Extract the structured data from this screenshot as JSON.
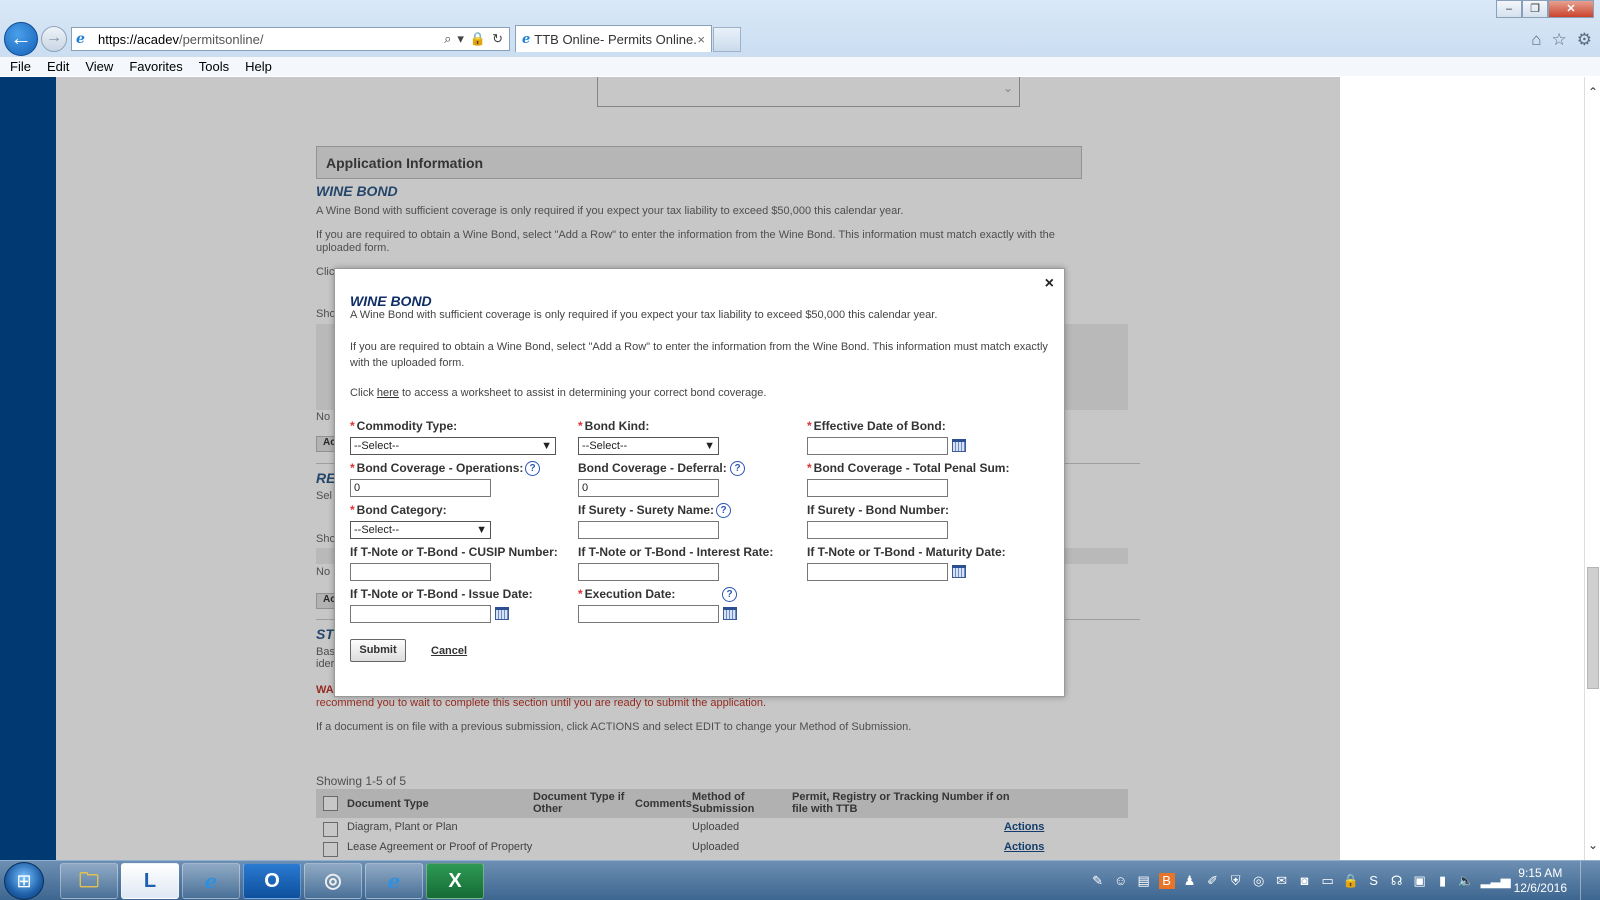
{
  "browser": {
    "url_host": "https://acadev",
    "url_path": "/permitsonline/",
    "tab_title": "TTB Online- Permits Online...",
    "tab_close": "×",
    "menu": [
      "File",
      "Edit",
      "View",
      "Favorites",
      "Tools",
      "Help"
    ],
    "window_controls": {
      "minimize": "–",
      "restore": "❐",
      "close": "✕"
    }
  },
  "background_page": {
    "section_header": "Application Information",
    "wine_bond_title": "WINE BOND",
    "wine_bond_p1": "A Wine Bond with sufficient coverage is only required if you expect your tax liability to exceed $50,000 this calendar year.",
    "wine_bond_p2": "If you are required to obtain a Wine Bond, select \"Add a Row\" to enter the information from the Wine Bond. This information must match exactly with the uploaded form.",
    "frag_click": "Clic",
    "frag_show1": "Sho",
    "frag_no1": "No",
    "frag_add1": "Ac",
    "frag_re": "RE",
    "frag_sel": "Sel",
    "frag_show2": "Sho",
    "frag_no2": "No",
    "frag_add2": "Ac",
    "frag_st": "ST",
    "frag_bas": "Bas",
    "frag_ider": "ider",
    "warning_label": "WARNING:",
    "warning_text": " Any information added within this Section will NOT be saved if you place the application in a Save and Resume Status. Therefore, we recommend you to wait to complete this section until you are ready to submit the application.",
    "doc_note": "If a document is on file with a previous submission, click ACTIONS and select EDIT to change your Method of Submission.",
    "showing": "Showing 1-5 of 5",
    "doc_headers": [
      "Document Type",
      "Document Type if Other",
      "Comments",
      "Method of Submission",
      "Permit, Registry or Tracking Number if on file with TTB"
    ],
    "doc_rows": [
      {
        "type": "Diagram, Plant or Plan",
        "method": "Uploaded",
        "actions": "Actions"
      },
      {
        "type": "Lease Agreement or Proof of Property",
        "method": "Uploaded",
        "actions": "Actions"
      }
    ]
  },
  "modal": {
    "close": "×",
    "title": "WINE BOND",
    "p1": "A Wine Bond with sufficient coverage is only required if you expect your tax liability to exceed $50,000 this calendar year.",
    "p2": "If you are required to obtain a Wine Bond, select \"Add a Row\" to enter the information from the Wine Bond. This information must match exactly with the uploaded form.",
    "p3_before": "Click ",
    "p3_link": "here",
    "p3_after": " to access a worksheet to assist in determining your correct bond coverage.",
    "required_mark": "*",
    "help_glyph": "?",
    "fields": {
      "commodity_type": {
        "label": "Commodity Type:",
        "value": "--Select--"
      },
      "bond_kind": {
        "label": "Bond Kind:",
        "value": "--Select--"
      },
      "effective_date": {
        "label": "Effective Date of Bond:",
        "value": ""
      },
      "coverage_operations": {
        "label": "Bond Coverage - Operations:",
        "value": "0"
      },
      "coverage_deferral": {
        "label": "Bond Coverage - Deferral:",
        "value": "0"
      },
      "coverage_total": {
        "label": "Bond Coverage - Total Penal Sum:",
        "value": ""
      },
      "bond_category": {
        "label": "Bond Category:",
        "value": "--Select--"
      },
      "surety_name": {
        "label": "If Surety - Surety Name:",
        "value": ""
      },
      "surety_bond_number": {
        "label": "If Surety - Bond Number:",
        "value": ""
      },
      "cusip_number": {
        "label": "If T-Note or T-Bond - CUSIP Number:",
        "value": ""
      },
      "interest_rate": {
        "label": "If T-Note or T-Bond - Interest Rate:",
        "value": ""
      },
      "maturity_date": {
        "label": "If T-Note or T-Bond - Maturity Date:",
        "value": ""
      },
      "issue_date": {
        "label": "If T-Note or T-Bond - Issue Date:",
        "value": ""
      },
      "execution_date": {
        "label": "Execution Date:",
        "value": ""
      }
    },
    "submit": "Submit",
    "cancel": "Cancel"
  },
  "taskbar": {
    "apps": [
      {
        "name": "file-explorer",
        "glyph": "🗀"
      },
      {
        "name": "lync",
        "glyph": "L"
      },
      {
        "name": "internet-explorer",
        "glyph": "e"
      },
      {
        "name": "outlook",
        "glyph": "O"
      },
      {
        "name": "app-circle",
        "glyph": "◎"
      },
      {
        "name": "internet-explorer-2",
        "glyph": "e"
      },
      {
        "name": "excel",
        "glyph": "X"
      }
    ],
    "time": "9:15 AM",
    "date": "12/6/2016"
  }
}
